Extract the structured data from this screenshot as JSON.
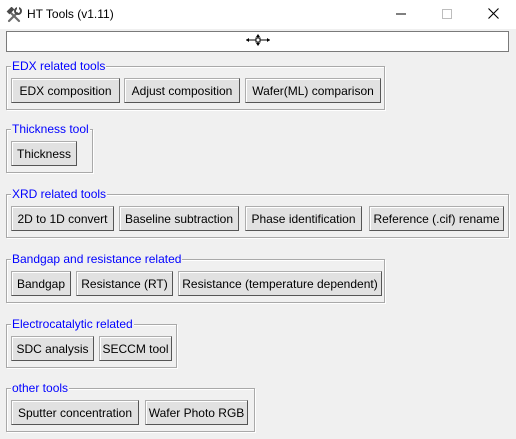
{
  "window": {
    "title": "HT Tools (v1.11)",
    "app_icon": "hammer-wrench-icon",
    "controls": [
      "minimize-icon",
      "maximize-icon",
      "close-icon"
    ]
  },
  "toolbar": {
    "handle_icon": "move-handle-icon"
  },
  "colors": {
    "group_label": "#0000ff",
    "background": "#f0f0f0",
    "button": "#e1e1e1"
  },
  "groups": {
    "edx": {
      "label": "EDX related tools",
      "buttons": [
        "EDX composition",
        "Adjust composition",
        "Wafer(ML) comparison"
      ]
    },
    "thickness": {
      "label": "Thickness tool",
      "buttons": [
        "Thickness"
      ]
    },
    "xrd": {
      "label": "XRD related tools",
      "buttons": [
        "2D to 1D convert",
        "Baseline subtraction",
        "Phase identification",
        "Reference (.cif) rename"
      ]
    },
    "bandgap": {
      "label": "Bandgap and resistance related",
      "buttons": [
        "Bandgap",
        "Resistance (RT)",
        "Resistance (temperature dependent)"
      ]
    },
    "electro": {
      "label": "Electrocatalytic related",
      "buttons": [
        "SDC analysis",
        "SECCM tool"
      ]
    },
    "other": {
      "label": "other tools",
      "buttons": [
        "Sputter concentration",
        "Wafer Photo RGB"
      ]
    }
  }
}
